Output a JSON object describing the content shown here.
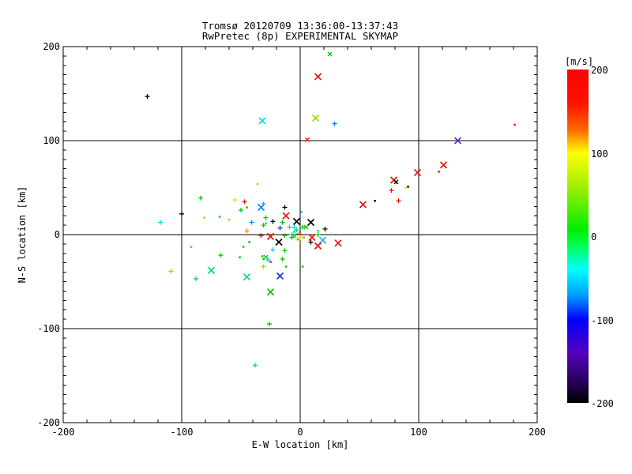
{
  "window": {
    "title": "Tromsø 20120709 13:36:00-13:37:43",
    "subtitle": "RwPretec (8p) EXPERIMENTAL SKYMAP"
  },
  "colors": {
    "background": "#ffffff",
    "axis": "#000000",
    "text": "#000000"
  },
  "chart_data": {
    "type": "scatter",
    "title": "Tromsø 20120709 13:36:00-13:37:43",
    "subtitle": "RwPretec (8p) EXPERIMENTAL SKYMAP",
    "xlabel": "E-W location [km]",
    "ylabel": "N-S location [km]",
    "xlim": [
      -200,
      200
    ],
    "ylim": [
      -200,
      200
    ],
    "x_ticks": [
      -200,
      -100,
      0,
      100,
      200
    ],
    "y_ticks": [
      -200,
      -100,
      0,
      100,
      200
    ],
    "x_minor_step": 20,
    "y_minor_step": 10,
    "grid_lines_x": [
      -100,
      0,
      100
    ],
    "grid_lines_y": [
      -100,
      0,
      100
    ],
    "colorbar": {
      "label": "[m/s]",
      "min": -200,
      "max": 200,
      "ticks": [
        200,
        100,
        0,
        -100,
        -200
      ],
      "gradient_top_to_bottom": [
        "#ff0000",
        "#ff6600",
        "#ffff00",
        "#99ee00",
        "#00ee00",
        "#00ffff",
        "#0000ff",
        "#5500bb",
        "#000000"
      ]
    },
    "marker_types": {
      "X": "large cross",
      "x": "small cross",
      "p": "plus",
      "d": "dot"
    },
    "points": [
      [
        25,
        192,
        "#00cc00",
        "x"
      ],
      [
        15,
        168,
        "#ee1100",
        "X"
      ],
      [
        -129,
        147,
        "#000000",
        "p"
      ],
      [
        -32,
        121,
        "#00dddd",
        "X"
      ],
      [
        13,
        124,
        "#99dd00",
        "X"
      ],
      [
        29,
        118,
        "#0088ff",
        "p"
      ],
      [
        6,
        101,
        "#ee1100",
        "x"
      ],
      [
        181,
        117,
        "#ee1100",
        "d"
      ],
      [
        133,
        100,
        "#6633cc",
        "X"
      ],
      [
        121,
        74,
        "#ee1100",
        "X"
      ],
      [
        117,
        67,
        "#ee1100",
        "d"
      ],
      [
        99,
        66,
        "#ee1100",
        "X"
      ],
      [
        79,
        58,
        "#ee1100",
        "X"
      ],
      [
        81,
        56,
        "#000000",
        "x"
      ],
      [
        77,
        47,
        "#ee1100",
        "p"
      ],
      [
        89,
        50,
        "#eedd00",
        "d"
      ],
      [
        91,
        51,
        "#000000",
        "d"
      ],
      [
        63,
        36,
        "#000000",
        "d"
      ],
      [
        83,
        36,
        "#ee1100",
        "p"
      ],
      [
        53,
        32,
        "#ee1100",
        "X"
      ],
      [
        -31,
        33,
        "#00ddaa",
        "p"
      ],
      [
        -13,
        29,
        "#000000",
        "p"
      ],
      [
        -12,
        20,
        "#ee1100",
        "X"
      ],
      [
        1,
        24,
        "#22aaff",
        "d"
      ],
      [
        -29,
        18,
        "#00cc00",
        "p"
      ],
      [
        -23,
        14,
        "#000000",
        "p"
      ],
      [
        -15,
        13,
        "#00cc00",
        "p"
      ],
      [
        -3,
        14,
        "#000000",
        "X"
      ],
      [
        9,
        13,
        "#000000",
        "X"
      ],
      [
        -31,
        10,
        "#00cc00",
        "p"
      ],
      [
        -17,
        7,
        "#2233dd",
        "p"
      ],
      [
        -9,
        8,
        "#00ddaa",
        "p"
      ],
      [
        -5,
        8,
        "#00dddd",
        "p"
      ],
      [
        2,
        8,
        "#00cc00",
        "p"
      ],
      [
        5,
        8,
        "#00cc00",
        "x"
      ],
      [
        15,
        4,
        "#00dddd",
        "d"
      ],
      [
        21,
        6,
        "#000000",
        "p"
      ],
      [
        -33,
        -1,
        "#ee1100",
        "p"
      ],
      [
        -25,
        -2,
        "#ee1100",
        "X"
      ],
      [
        -13,
        -1,
        "#00cc00",
        "p"
      ],
      [
        -7,
        0,
        "#00ddaa",
        "p"
      ],
      [
        -5,
        -1,
        "#00cc00",
        "x"
      ],
      [
        -1,
        1,
        "#ff8800",
        "p"
      ],
      [
        0,
        -3,
        "#eedd00",
        "p"
      ],
      [
        3,
        -3,
        "#ff8800",
        "d"
      ],
      [
        10,
        -3,
        "#ee1100",
        "X"
      ],
      [
        15,
        0,
        "#00cc00",
        "p"
      ],
      [
        -18,
        -8,
        "#000000",
        "X"
      ],
      [
        0,
        -8,
        "#ff8800",
        "d"
      ],
      [
        9,
        -8,
        "#000000",
        "p"
      ],
      [
        19,
        -6,
        "#22aaff",
        "X"
      ],
      [
        15,
        -12,
        "#ee1100",
        "X"
      ],
      [
        32,
        -9,
        "#ee1100",
        "X"
      ],
      [
        -23,
        -16,
        "#00dddd",
        "p"
      ],
      [
        -13,
        -17,
        "#00cc00",
        "p"
      ],
      [
        -29,
        -24,
        "#00cc00",
        "x"
      ],
      [
        -27,
        -27,
        "#00dddd",
        "p"
      ],
      [
        -25,
        -29,
        "#ee1100",
        "d"
      ],
      [
        -15,
        -26,
        "#00cc00",
        "p"
      ],
      [
        -12,
        -34,
        "#00cc00",
        "d"
      ],
      [
        2,
        -34,
        "#00cc00",
        "d"
      ],
      [
        -31,
        -34,
        "#99dd00",
        "p"
      ],
      [
        -45,
        -45,
        "#00dd77",
        "X"
      ],
      [
        -17,
        -44,
        "#2233dd",
        "X"
      ],
      [
        -25,
        -61,
        "#00cc00",
        "X"
      ],
      [
        -26,
        -95,
        "#00cc00",
        "p"
      ],
      [
        -38,
        -139,
        "#00dd77",
        "p"
      ],
      [
        -118,
        13,
        "#00dddd",
        "p"
      ],
      [
        -100,
        22,
        "#000000",
        "p"
      ],
      [
        -92,
        -13,
        "#00ddaa",
        "d"
      ],
      [
        -109,
        -39,
        "#99dd00",
        "p"
      ],
      [
        -75,
        -38,
        "#00dd77",
        "X"
      ],
      [
        -88,
        -47,
        "#00dd77",
        "p"
      ],
      [
        -84,
        39,
        "#00cc00",
        "p"
      ],
      [
        -81,
        18,
        "#99dd00",
        "d"
      ],
      [
        -68,
        19,
        "#00cc00",
        "d"
      ],
      [
        -60,
        16,
        "#99dd00",
        "d"
      ],
      [
        -55,
        37,
        "#eedd00",
        "p"
      ],
      [
        -47,
        35,
        "#ee1100",
        "p"
      ],
      [
        -50,
        26,
        "#00cc00",
        "p"
      ],
      [
        -45,
        29,
        "#00cc00",
        "d"
      ],
      [
        -36,
        54,
        "#99dd00",
        "d"
      ],
      [
        -33,
        29,
        "#0088ff",
        "X"
      ],
      [
        -41,
        13,
        "#0088ff",
        "p"
      ],
      [
        -45,
        4,
        "#ff8800",
        "p"
      ],
      [
        -29,
        12,
        "#00ddaa",
        "d"
      ],
      [
        -67,
        -22,
        "#00cc00",
        "p"
      ],
      [
        -51,
        -24,
        "#00cc00",
        "d"
      ],
      [
        -32,
        -23,
        "#00cc00",
        "d"
      ],
      [
        -31,
        -26,
        "#00cc00",
        "d"
      ],
      [
        -48,
        -13,
        "#00cc00",
        "d"
      ],
      [
        -43,
        -8,
        "#00cc00",
        "d"
      ],
      [
        -5,
        3,
        "#00ddaa",
        "d"
      ],
      [
        -3,
        5,
        "#00dd77",
        "p"
      ],
      [
        -7,
        -3,
        "#00cc00",
        "p"
      ],
      [
        -2,
        -5,
        "#00cc00",
        "d"
      ]
    ]
  }
}
